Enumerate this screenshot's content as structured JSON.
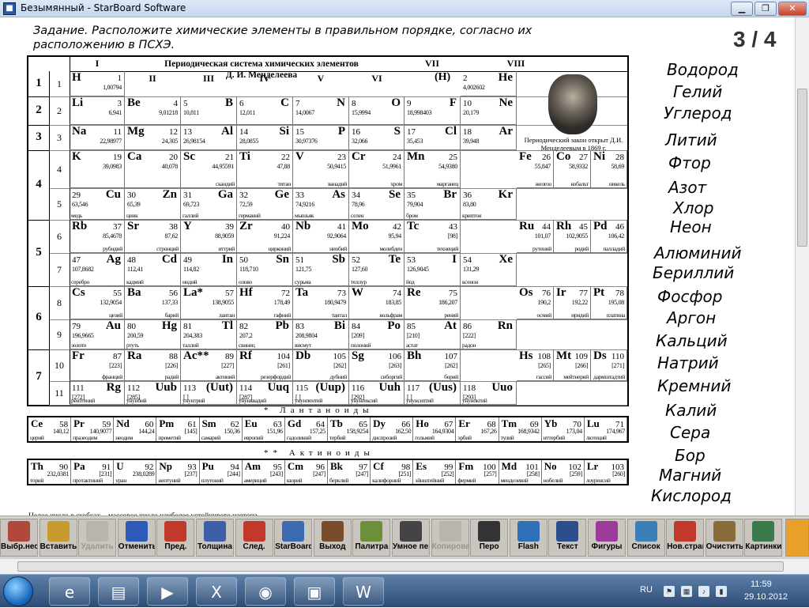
{
  "window": {
    "title": "Безымянный - StarBoard Software",
    "min": "▁",
    "max": "❐",
    "close": "✕"
  },
  "task": {
    "text": "Задание. Расположите химические элементы в правильном порядке, согласно их расположению в ПСХЭ.",
    "page": "3 / 4"
  },
  "table": {
    "title": "Периодическая система химических элементов\nД. И. Менделеева",
    "groups": [
      "I",
      "II",
      "III",
      "IV",
      "V",
      "VI",
      "VII",
      "VIII"
    ],
    "h_paren": "(H)",
    "portrait_caption": "Периодический закон открыт Д.И. Менделеевым в 1869 г.",
    "lanthanides_label": "* Лантаноиды",
    "actinides_label": "** Актиноиды",
    "footnote": "Целое число в скобках – массовое число наиболее устойчивого изотопа",
    "periods": [
      "1",
      "2",
      "3",
      "4",
      "5",
      "6",
      "7"
    ],
    "rows": [
      "1",
      "2",
      "3",
      "4",
      "5",
      "6",
      "7",
      "8",
      "9",
      "10",
      "11"
    ],
    "elements": [
      [
        "H",
        "1",
        "1,00794",
        "",
        0,
        1,
        "L"
      ],
      [
        "He",
        "2",
        "4,002602",
        "",
        0,
        8,
        "R"
      ],
      [
        "Li",
        "3",
        "6,941",
        "",
        1,
        1,
        "L"
      ],
      [
        "Be",
        "4",
        "9,01218",
        "",
        1,
        2,
        "L"
      ],
      [
        "B",
        "5",
        "10,811",
        "",
        1,
        3,
        "R"
      ],
      [
        "C",
        "6",
        "12,011",
        "",
        1,
        4,
        "R"
      ],
      [
        "N",
        "7",
        "14,0067",
        "",
        1,
        5,
        "R"
      ],
      [
        "O",
        "8",
        "15,9994",
        "",
        1,
        6,
        "R"
      ],
      [
        "F",
        "9",
        "18,998403",
        "",
        1,
        7,
        "R"
      ],
      [
        "Ne",
        "10",
        "20,179",
        "",
        1,
        8,
        "R"
      ],
      [
        "Na",
        "11",
        "22,98977",
        "",
        2,
        1,
        "L"
      ],
      [
        "Mg",
        "12",
        "24,305",
        "",
        2,
        2,
        "L"
      ],
      [
        "Al",
        "13",
        "26,98154",
        "",
        2,
        3,
        "R"
      ],
      [
        "Si",
        "14",
        "28,0855",
        "",
        2,
        4,
        "R"
      ],
      [
        "P",
        "15",
        "30,97376",
        "",
        2,
        5,
        "R"
      ],
      [
        "S",
        "16",
        "32,066",
        "",
        2,
        6,
        "R"
      ],
      [
        "Cl",
        "17",
        "35,453",
        "",
        2,
        7,
        "R"
      ],
      [
        "Ar",
        "18",
        "39,948",
        "",
        2,
        8,
        "R"
      ],
      [
        "K",
        "19",
        "39,0983",
        "",
        3,
        1,
        "L"
      ],
      [
        "Ca",
        "20",
        "40,078",
        "",
        3,
        2,
        "L"
      ],
      [
        "Sc",
        "21",
        "44,95591",
        "скандий",
        3,
        3,
        "L"
      ],
      [
        "Ti",
        "22",
        "47,88",
        "титан",
        3,
        4,
        "L"
      ],
      [
        "V",
        "23",
        "50,9415",
        "ванадий",
        3,
        5,
        "L"
      ],
      [
        "Cr",
        "24",
        "51,9961",
        "хром",
        3,
        6,
        "L"
      ],
      [
        "Mn",
        "25",
        "54,9380",
        "марганец",
        3,
        7,
        "L"
      ],
      [
        "Fe",
        "26",
        "55,847",
        "железо",
        3,
        8,
        "L"
      ],
      [
        "Co",
        "27",
        "58,9332",
        "кобальт",
        3,
        9,
        "L"
      ],
      [
        "Ni",
        "28",
        "58,69",
        "никель",
        3,
        10,
        "L"
      ],
      [
        "Cu",
        "29",
        "63,546",
        "медь",
        4,
        1,
        "R"
      ],
      [
        "Zn",
        "30",
        "65,39",
        "цинк",
        4,
        2,
        "R"
      ],
      [
        "Ga",
        "31",
        "69,723",
        "галлий",
        4,
        3,
        "R"
      ],
      [
        "Ge",
        "32",
        "72,59",
        "германий",
        4,
        4,
        "R"
      ],
      [
        "As",
        "33",
        "74,9216",
        "мышьяк",
        4,
        5,
        "R"
      ],
      [
        "Se",
        "34",
        "78,96",
        "селен",
        4,
        6,
        "R"
      ],
      [
        "Br",
        "35",
        "79,904",
        "бром",
        4,
        7,
        "R"
      ],
      [
        "Kr",
        "36",
        "83,80",
        "криптон",
        4,
        8,
        "R"
      ],
      [
        "Rb",
        "37",
        "85,4678",
        "рубидий",
        5,
        1,
        "L"
      ],
      [
        "Sr",
        "38",
        "87,62",
        "стронций",
        5,
        2,
        "L"
      ],
      [
        "Y",
        "39",
        "88,9059",
        "иттрий",
        5,
        3,
        "L"
      ],
      [
        "Zr",
        "40",
        "91,224",
        "цирконий",
        5,
        4,
        "L"
      ],
      [
        "Nb",
        "41",
        "92,9064",
        "ниобий",
        5,
        5,
        "L"
      ],
      [
        "Mo",
        "42",
        "95,94",
        "молибден",
        5,
        6,
        "L"
      ],
      [
        "Tc",
        "43",
        "[98]",
        "технеций",
        5,
        7,
        "L"
      ],
      [
        "Ru",
        "44",
        "101,07",
        "рутений",
        5,
        8,
        "L"
      ],
      [
        "Rh",
        "45",
        "102,9055",
        "родий",
        5,
        9,
        "L"
      ],
      [
        "Pd",
        "46",
        "106,42",
        "палладий",
        5,
        10,
        "L"
      ],
      [
        "Ag",
        "47",
        "107,8682",
        "серебро",
        6,
        1,
        "R"
      ],
      [
        "Cd",
        "48",
        "112,41",
        "кадмий",
        6,
        2,
        "R"
      ],
      [
        "In",
        "49",
        "114,82",
        "индий",
        6,
        3,
        "R"
      ],
      [
        "Sn",
        "50",
        "118,710",
        "олово",
        6,
        4,
        "R"
      ],
      [
        "Sb",
        "51",
        "121,75",
        "сурьма",
        6,
        5,
        "R"
      ],
      [
        "Te",
        "52",
        "127,60",
        "теллур",
        6,
        6,
        "R"
      ],
      [
        "I",
        "53",
        "126,9045",
        "йод",
        6,
        7,
        "R"
      ],
      [
        "Xe",
        "54",
        "131,29",
        "ксенон",
        6,
        8,
        "R"
      ],
      [
        "Cs",
        "55",
        "132,9054",
        "цезий",
        7,
        1,
        "L"
      ],
      [
        "Ba",
        "56",
        "137,33",
        "барий",
        7,
        2,
        "L"
      ],
      [
        "La*",
        "57",
        "138,9055",
        "лантан",
        7,
        3,
        "L"
      ],
      [
        "Hf",
        "72",
        "178,49",
        "гафний",
        7,
        4,
        "L"
      ],
      [
        "Ta",
        "73",
        "180,9479",
        "тантал",
        7,
        5,
        "L"
      ],
      [
        "W",
        "74",
        "183,85",
        "вольфрам",
        7,
        6,
        "L"
      ],
      [
        "Re",
        "75",
        "186,207",
        "рений",
        7,
        7,
        "L"
      ],
      [
        "Os",
        "76",
        "190,2",
        "осмий",
        7,
        8,
        "L"
      ],
      [
        "Ir",
        "77",
        "192,22",
        "иридий",
        7,
        9,
        "L"
      ],
      [
        "Pt",
        "78",
        "195,08",
        "платина",
        7,
        10,
        "L"
      ],
      [
        "Au",
        "79",
        "196,9665",
        "золото",
        8,
        1,
        "R"
      ],
      [
        "Hg",
        "80",
        "200,59",
        "ртуть",
        8,
        2,
        "R"
      ],
      [
        "Tl",
        "81",
        "204,383",
        "таллий",
        8,
        3,
        "R"
      ],
      [
        "Pb",
        "82",
        "207,2",
        "свинец",
        8,
        4,
        "R"
      ],
      [
        "Bi",
        "83",
        "208,9804",
        "висмут",
        8,
        5,
        "R"
      ],
      [
        "Po",
        "84",
        "[209]",
        "полоний",
        8,
        6,
        "R"
      ],
      [
        "At",
        "85",
        "[210]",
        "астат",
        8,
        7,
        "R"
      ],
      [
        "Rn",
        "86",
        "[222]",
        "радон",
        8,
        8,
        "R"
      ],
      [
        "Fr",
        "87",
        "[223]",
        "франций",
        9,
        1,
        "L"
      ],
      [
        "Ra",
        "88",
        "[226]",
        "радий",
        9,
        2,
        "L"
      ],
      [
        "Ac**",
        "89",
        "[227]",
        "актиний",
        9,
        3,
        "L"
      ],
      [
        "Rf",
        "104",
        "[261]",
        "резерфордий",
        9,
        4,
        "L"
      ],
      [
        "Db",
        "105",
        "[262]",
        "дубний",
        9,
        5,
        "L"
      ],
      [
        "Sg",
        "106",
        "[263]",
        "сиборгий",
        9,
        6,
        "L"
      ],
      [
        "Bh",
        "107",
        "[262]",
        "борий",
        9,
        7,
        "L"
      ],
      [
        "Hs",
        "108",
        "[265]",
        "гассий",
        9,
        8,
        "L"
      ],
      [
        "Mt",
        "109",
        "[266]",
        "мейтнерий",
        9,
        9,
        "L"
      ],
      [
        "Ds",
        "110",
        "[271]",
        "дармштадтий",
        9,
        10,
        "L"
      ],
      [
        "Rg",
        "111",
        "[272]",
        "рентгений",
        10,
        1,
        "R"
      ],
      [
        "Uub",
        "112",
        "[285]",
        "унунбий",
        10,
        2,
        "R"
      ],
      [
        "(Uut)",
        "113",
        "[ ]",
        "унунтрий",
        10,
        3,
        "R"
      ],
      [
        "Uuq",
        "114",
        "[287]",
        "унунквадий",
        10,
        4,
        "R"
      ],
      [
        "(Uup)",
        "115",
        "[ ]",
        "унунпентий",
        10,
        5,
        "R"
      ],
      [
        "Uuh",
        "116",
        "[292]",
        "унунгексий",
        10,
        6,
        "R"
      ],
      [
        "(Uus)",
        "117",
        "[ ]",
        "унунсептий",
        10,
        7,
        "R"
      ],
      [
        "Uuo",
        "118",
        "[293]",
        "унуноктий",
        10,
        8,
        "R"
      ]
    ],
    "lanthanides": [
      [
        "Ce",
        "58",
        "140,12",
        "церий"
      ],
      [
        "Pr",
        "59",
        "140,9077",
        "празеодим"
      ],
      [
        "Nd",
        "60",
        "144,24",
        "неодим"
      ],
      [
        "Pm",
        "61",
        "[145]",
        "прометий"
      ],
      [
        "Sm",
        "62",
        "150,36",
        "самарий"
      ],
      [
        "Eu",
        "63",
        "151,96",
        "европий"
      ],
      [
        "Gd",
        "64",
        "157,25",
        "гадолиний"
      ],
      [
        "Tb",
        "65",
        "158,9254",
        "тербий"
      ],
      [
        "Dy",
        "66",
        "162,50",
        "диспрозий"
      ],
      [
        "Ho",
        "67",
        "164,9304",
        "гольмий"
      ],
      [
        "Er",
        "68",
        "167,26",
        "эрбий"
      ],
      [
        "Tm",
        "69",
        "168,9342",
        "тулий"
      ],
      [
        "Yb",
        "70",
        "173,04",
        "иттербий"
      ],
      [
        "Lu",
        "71",
        "174,967",
        "лютеций"
      ]
    ],
    "actinides": [
      [
        "Th",
        "90",
        "232,0381",
        "торий"
      ],
      [
        "Pa",
        "91",
        "[231]",
        "протактиний"
      ],
      [
        "U",
        "92",
        "238,0289",
        "уран"
      ],
      [
        "Np",
        "93",
        "[237]",
        "нептуний"
      ],
      [
        "Pu",
        "94",
        "[244]",
        "плутоний"
      ],
      [
        "Am",
        "95",
        "[243]",
        "америций"
      ],
      [
        "Cm",
        "96",
        "[247]",
        "кюрий"
      ],
      [
        "Bk",
        "97",
        "[247]",
        "берклий"
      ],
      [
        "Cf",
        "98",
        "[251]",
        "калифорний"
      ],
      [
        "Es",
        "99",
        "[252]",
        "эйнштейний"
      ],
      [
        "Fm",
        "100",
        "[257]",
        "фермий"
      ],
      [
        "Md",
        "101",
        "[258]",
        "менделевий"
      ],
      [
        "No",
        "102",
        "[259]",
        "нобелий"
      ],
      [
        "Lr",
        "103",
        "[260]",
        "лоуренсий"
      ]
    ]
  },
  "element_names": [
    "Водород",
    "Гелий",
    "Углерод",
    "Литий",
    "Фтор",
    "Азот",
    "Хлор",
    "Неон",
    "Алюминий",
    "Бериллий",
    "Фосфор",
    "Аргон",
    "Кальций",
    "Натрий",
    "Кремний",
    "Калий",
    "Сера",
    "Бор",
    "Магний",
    "Кислород"
  ],
  "toolbar": [
    {
      "label": "Выбр.неск.",
      "icon": "multi-select-icon",
      "color": "#b0483c"
    },
    {
      "label": "Вставить",
      "icon": "paste-icon",
      "color": "#c89b2f"
    },
    {
      "label": "Удалить",
      "icon": "delete-icon",
      "color": "#b8b4ae",
      "disabled": true
    },
    {
      "label": "Отменить",
      "icon": "undo-icon",
      "color": "#2e5ab7"
    },
    {
      "label": "Пред.",
      "icon": "prev-page-icon",
      "color": "#c2392b"
    },
    {
      "label": "Толщина",
      "icon": "line-width-icon",
      "color": "#3b5fa8"
    },
    {
      "label": "След.",
      "icon": "next-page-icon",
      "color": "#c2392b"
    },
    {
      "label": "StarBoard",
      "icon": "starboard-icon",
      "color": "#3a6ab0"
    },
    {
      "label": "Выход",
      "icon": "exit-icon",
      "color": "#7a4d2a"
    },
    {
      "label": "Палитра",
      "icon": "palette-icon",
      "color": "#6b8f3a"
    },
    {
      "label": "Умное перо",
      "icon": "smart-pen-icon",
      "color": "#444"
    },
    {
      "label": "Копировать",
      "icon": "copy-icon",
      "color": "#b8b4ae",
      "disabled": true
    },
    {
      "label": "Перо",
      "icon": "pen-icon",
      "color": "#333"
    },
    {
      "label": "Flash",
      "icon": "flash-icon",
      "color": "#2f6fb8"
    },
    {
      "label": "Текст",
      "icon": "text-icon",
      "color": "#2b4f8e"
    },
    {
      "label": "Фигуры",
      "icon": "shapes-icon",
      "color": "#9c3b9a"
    },
    {
      "label": "Список",
      "icon": "list-icon",
      "color": "#3b7fb8"
    },
    {
      "label": "Нов.стран.",
      "icon": "new-page-icon",
      "color": "#c2392b"
    },
    {
      "label": "Очистить",
      "icon": "clear-icon",
      "color": "#8a6b3a"
    },
    {
      "label": "Картинки",
      "icon": "pictures-icon",
      "color": "#3a7a4a"
    }
  ],
  "taskbar": {
    "apps": [
      {
        "name": "ie-icon",
        "glyph": "e"
      },
      {
        "name": "explorer-icon",
        "glyph": "▤"
      },
      {
        "name": "media-player-icon",
        "glyph": "▶"
      },
      {
        "name": "excel-icon",
        "glyph": "X"
      },
      {
        "name": "firefox-icon",
        "glyph": "◉"
      },
      {
        "name": "starboard-icon",
        "glyph": "▣"
      },
      {
        "name": "word-icon",
        "glyph": "W"
      }
    ],
    "lang": "RU",
    "time": "11:59",
    "date": "29.10.2012"
  }
}
